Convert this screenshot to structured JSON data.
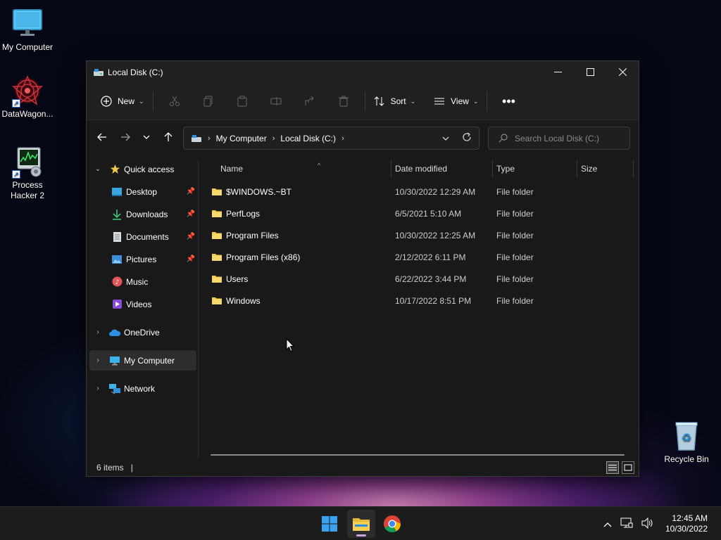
{
  "desktop": {
    "icons": [
      {
        "label": "My Computer",
        "icon": "monitor-icon"
      },
      {
        "label": "DataWagon...",
        "icon": "datawagon-icon"
      },
      {
        "label": "Process Hacker 2",
        "icon": "process-hacker-icon"
      },
      {
        "label": "Recycle Bin",
        "icon": "recycle-bin-icon"
      }
    ]
  },
  "window": {
    "title": "Local Disk (C:)",
    "controls": {
      "minimize": "minimize-icon",
      "maximize": "maximize-icon",
      "close": "close-icon"
    }
  },
  "toolbar": {
    "new_label": "New",
    "sort_label": "Sort",
    "view_label": "View",
    "icons": [
      "cut-icon",
      "copy-icon",
      "paste-icon",
      "rename-icon",
      "share-icon",
      "delete-icon",
      "more-icon"
    ]
  },
  "address": {
    "crumbs": [
      "My Computer",
      "Local Disk (C:)"
    ],
    "search_placeholder": "Search Local Disk (C:)"
  },
  "navpane": {
    "quick_access": "Quick access",
    "pinned": [
      {
        "label": "Desktop",
        "pinned": true
      },
      {
        "label": "Downloads",
        "pinned": true
      },
      {
        "label": "Documents",
        "pinned": true
      },
      {
        "label": "Pictures",
        "pinned": true
      },
      {
        "label": "Music",
        "pinned": false
      },
      {
        "label": "Videos",
        "pinned": false
      }
    ],
    "onedrive": "OneDrive",
    "my_computer": "My Computer",
    "network": "Network"
  },
  "columns": {
    "name": "Name",
    "date": "Date modified",
    "type": "Type",
    "size": "Size"
  },
  "files": [
    {
      "name": "$WINDOWS.~BT",
      "date": "10/30/2022 12:29 AM",
      "type": "File folder"
    },
    {
      "name": "PerfLogs",
      "date": "6/5/2021 5:10 AM",
      "type": "File folder"
    },
    {
      "name": "Program Files",
      "date": "10/30/2022 12:25 AM",
      "type": "File folder"
    },
    {
      "name": "Program Files (x86)",
      "date": "2/12/2022 6:11 PM",
      "type": "File folder"
    },
    {
      "name": "Users",
      "date": "6/22/2022 3:44 PM",
      "type": "File folder"
    },
    {
      "name": "Windows",
      "date": "10/17/2022 8:51 PM",
      "type": "File folder"
    }
  ],
  "status": {
    "items": "6 items",
    "caret": "|"
  },
  "taskbar": {
    "apps": [
      "windows-start-icon",
      "file-explorer-icon",
      "chrome-icon"
    ],
    "clock_time": "12:45 AM",
    "clock_date": "10/30/2022"
  },
  "colors": {
    "window_bg": "#191919",
    "titlebar_bg": "#202020",
    "folder": "#f2c94c",
    "accent": "#0078d4"
  }
}
